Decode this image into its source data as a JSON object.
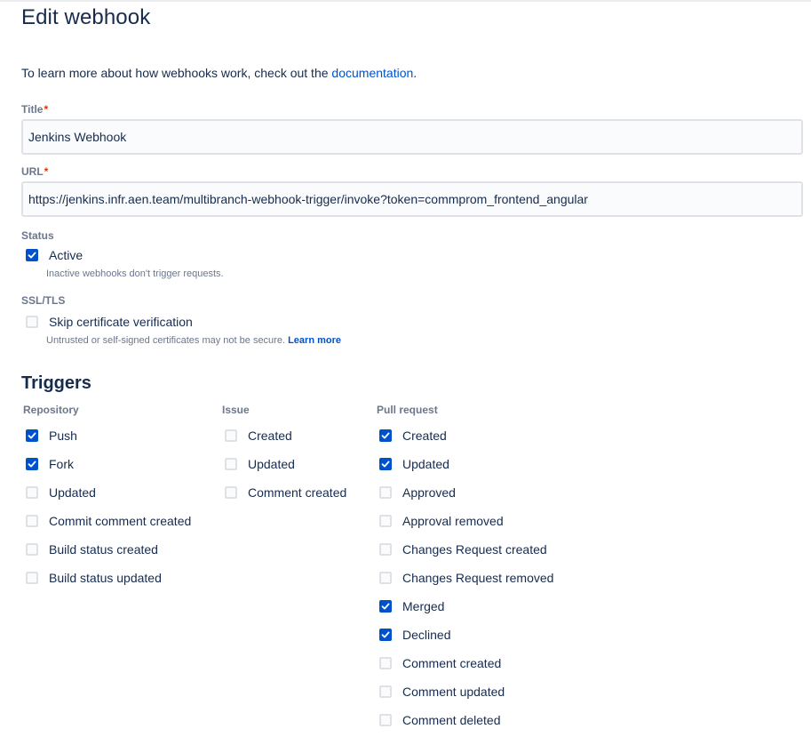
{
  "page": {
    "title": "Edit webhook",
    "intro_prefix": "To learn more about how webhooks work, check out the ",
    "intro_link": "documentation",
    "intro_suffix": "."
  },
  "form": {
    "title_label": "Title",
    "title_value": "Jenkins Webhook",
    "url_label": "URL",
    "url_value": "https://jenkins.infr.aen.team/multibranch-webhook-trigger/invoke?token=commprom_frontend_angular",
    "required_mark": "*",
    "status_label": "Status",
    "active": {
      "label": "Active",
      "checked": true,
      "help": "Inactive webhooks don't trigger requests."
    },
    "ssl_label": "SSL/TLS",
    "skip_cert": {
      "label": "Skip certificate verification",
      "checked": false,
      "help": "Untrusted or self-signed certificates may not be secure.",
      "help_link": "Learn more"
    }
  },
  "triggers": {
    "title": "Triggers",
    "repository": {
      "heading": "Repository",
      "items": [
        {
          "label": "Push",
          "checked": true
        },
        {
          "label": "Fork",
          "checked": true
        },
        {
          "label": "Updated",
          "checked": false
        },
        {
          "label": "Commit comment created",
          "checked": false
        },
        {
          "label": "Build status created",
          "checked": false
        },
        {
          "label": "Build status updated",
          "checked": false
        }
      ]
    },
    "issue": {
      "heading": "Issue",
      "items": [
        {
          "label": "Created",
          "checked": false
        },
        {
          "label": "Updated",
          "checked": false
        },
        {
          "label": "Comment created",
          "checked": false
        }
      ]
    },
    "pull_request": {
      "heading": "Pull request",
      "items": [
        {
          "label": "Created",
          "checked": true
        },
        {
          "label": "Updated",
          "checked": true
        },
        {
          "label": "Approved",
          "checked": false
        },
        {
          "label": "Approval removed",
          "checked": false
        },
        {
          "label": "Changes Request created",
          "checked": false
        },
        {
          "label": "Changes Request removed",
          "checked": false
        },
        {
          "label": "Merged",
          "checked": true
        },
        {
          "label": "Declined",
          "checked": true
        },
        {
          "label": "Comment created",
          "checked": false
        },
        {
          "label": "Comment updated",
          "checked": false
        },
        {
          "label": "Comment deleted",
          "checked": false
        }
      ]
    }
  },
  "colors": {
    "accent": "#0052cc",
    "text": "#172b4d",
    "subtle": "#6b778c",
    "required": "#de350b"
  }
}
